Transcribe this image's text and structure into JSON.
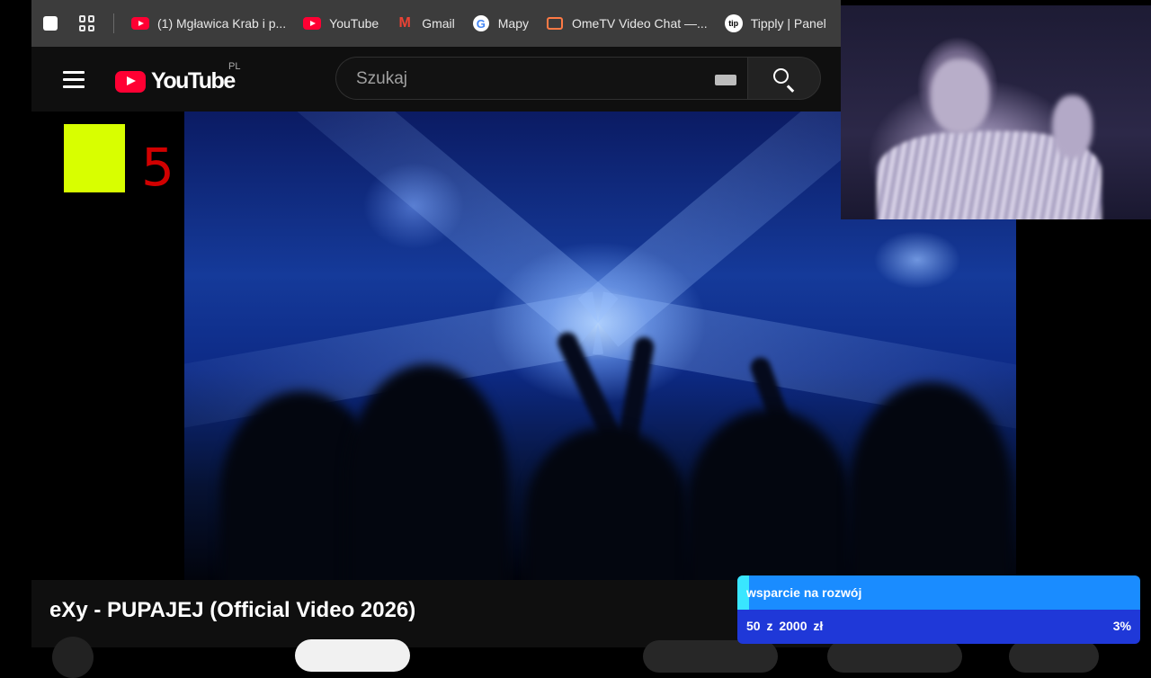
{
  "bookmarks_bar": {
    "items": [
      {
        "label": "(1) Mgławica Krab i p...",
        "icon": "youtube-icon"
      },
      {
        "label": "YouTube",
        "icon": "youtube-icon"
      },
      {
        "label": "Gmail",
        "icon": "gmail-icon"
      },
      {
        "label": "Mapy",
        "icon": "google-icon"
      },
      {
        "label": "OmeTV Video Chat —...",
        "icon": "tv-icon"
      },
      {
        "label": "Tipply | Panel",
        "icon": "tipply-icon"
      }
    ]
  },
  "header": {
    "logo_text": "YouTube",
    "logo_country": "PL",
    "search_placeholder": "Szukaj"
  },
  "channel_logo": {
    "number": "5"
  },
  "video": {
    "title": "eXy - PUPAJEJ (Official Video 2026)"
  },
  "donation_widget": {
    "goal_label": "wsparcie na rozwój",
    "amount_text": "50 z 2000 zł",
    "percent_text": "3%",
    "progress": 0.03
  },
  "colors": {
    "bar_bg": "#3c3c3c",
    "header_bg": "#0f0f0f",
    "youtube_red": "#ff0033",
    "k5_yellow": "#d8ff00",
    "k5_red": "#d10000",
    "goal_fill": "#39e6ff",
    "goal_bg": "#1a8cff",
    "amount_bg": "#1f38d8"
  }
}
